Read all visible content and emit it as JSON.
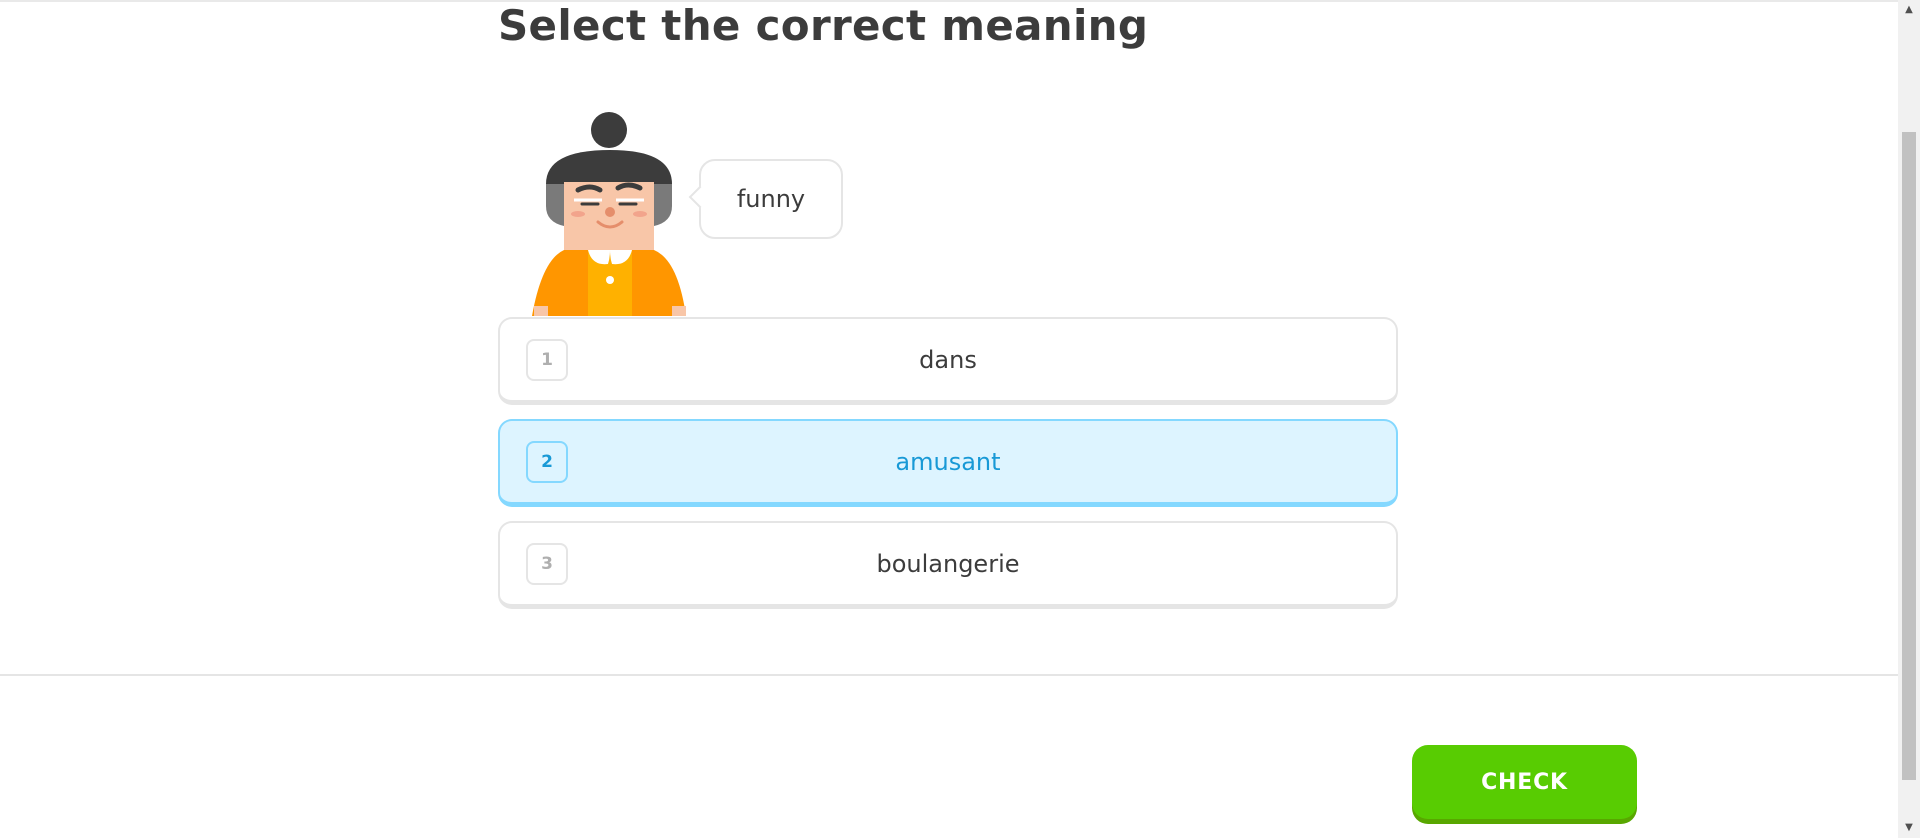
{
  "prompt": {
    "title": "Select the correct meaning"
  },
  "speech_bubble": {
    "text": "funny"
  },
  "character": {
    "name": "character-icon"
  },
  "choices": [
    {
      "number": "1",
      "label": "dans",
      "selected": false
    },
    {
      "number": "2",
      "label": "amusant",
      "selected": true
    },
    {
      "number": "3",
      "label": "boulangerie",
      "selected": false
    }
  ],
  "footer": {
    "check_label": "CHECK"
  },
  "colors": {
    "accent_green": "#58cc02",
    "selected_blue": "#1899d6",
    "selected_bg": "#ddf4ff",
    "selected_border": "#84d8ff",
    "text": "#3c3c3c",
    "border": "#e5e5e5"
  },
  "icons": [
    "character-icon",
    "scroll-up-arrow-icon",
    "scroll-down-arrow-icon"
  ]
}
